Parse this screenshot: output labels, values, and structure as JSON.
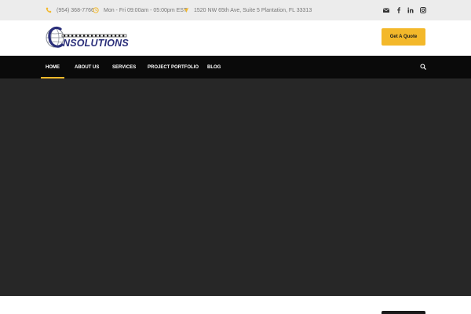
{
  "topbar": {
    "phone": "(954) 368-7766",
    "hours": "Mon - Fri 09:00am - 05:00pm EST",
    "address": "1520 NW 65th Ave, Suite 5 Plantation, FL 33313",
    "icons": {
      "phone": "phone-icon",
      "hours": "clock-icon",
      "address": "location-arrow-icon"
    },
    "social": [
      "envelope-icon",
      "facebook-icon",
      "linkedin-icon",
      "instagram-icon"
    ]
  },
  "header": {
    "logo_text": "NSOLUTIONS",
    "quote_label": "Get A Quote"
  },
  "nav": {
    "items": [
      {
        "label": "HOME",
        "active": true
      },
      {
        "label": "ABOUT US",
        "active": false
      },
      {
        "label": "SERVICES",
        "active": false
      },
      {
        "label": "PROJECT PORTFOLIO",
        "active": false
      },
      {
        "label": "BLOG",
        "active": false
      }
    ]
  },
  "colors": {
    "accent": "#f3b82a",
    "topbar_bg": "#ececec",
    "nav_bg": "#0a0a0a",
    "hero_bg": "#272727",
    "logo_blue": "#2b2f7a"
  }
}
